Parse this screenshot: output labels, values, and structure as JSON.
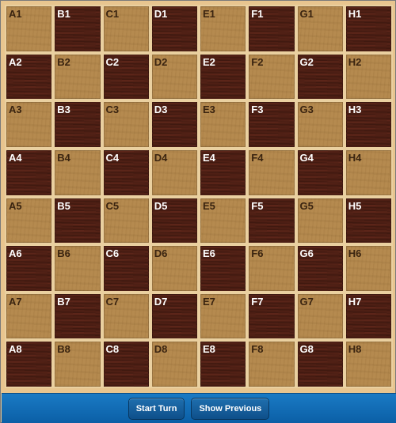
{
  "board": {
    "columns": [
      "A",
      "B",
      "C",
      "D",
      "E",
      "F",
      "G",
      "H"
    ],
    "rows": [
      "1",
      "2",
      "3",
      "4",
      "5",
      "6",
      "7",
      "8"
    ],
    "light_color": "#b58a4f",
    "dark_color": "#4e1f14"
  },
  "toolbar": {
    "start_turn_label": "Start Turn",
    "show_previous_label": "Show Previous",
    "bar_color": "#0b5fa6"
  }
}
